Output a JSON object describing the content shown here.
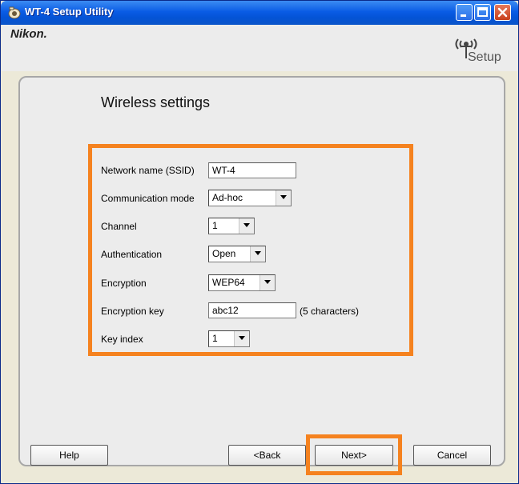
{
  "window": {
    "title": "WT-4 Setup Utility"
  },
  "header": {
    "logo": "Nikon.",
    "setup_label": "Setup"
  },
  "page": {
    "heading": "Wireless settings"
  },
  "form": {
    "network_name": {
      "label": "Network name (SSID)",
      "value": "WT-4"
    },
    "communication_mode": {
      "label": "Communication mode",
      "value": "Ad-hoc"
    },
    "channel": {
      "label": "Channel",
      "value": "1"
    },
    "authentication": {
      "label": "Authentication",
      "value": "Open"
    },
    "encryption": {
      "label": "Encryption",
      "value": "WEP64"
    },
    "encryption_key": {
      "label": "Encryption key",
      "value": "abc12",
      "hint": "(5 characters)"
    },
    "key_index": {
      "label": "Key index",
      "value": "1"
    }
  },
  "buttons": {
    "help": "Help",
    "back": "<Back",
    "next": "Next>",
    "cancel": "Cancel"
  },
  "colors": {
    "highlight": "#f5821f",
    "titlebar": "#0a5ce5"
  },
  "icons": {
    "app": "nikon-app-icon",
    "setup": "wireless-setup-icon"
  }
}
